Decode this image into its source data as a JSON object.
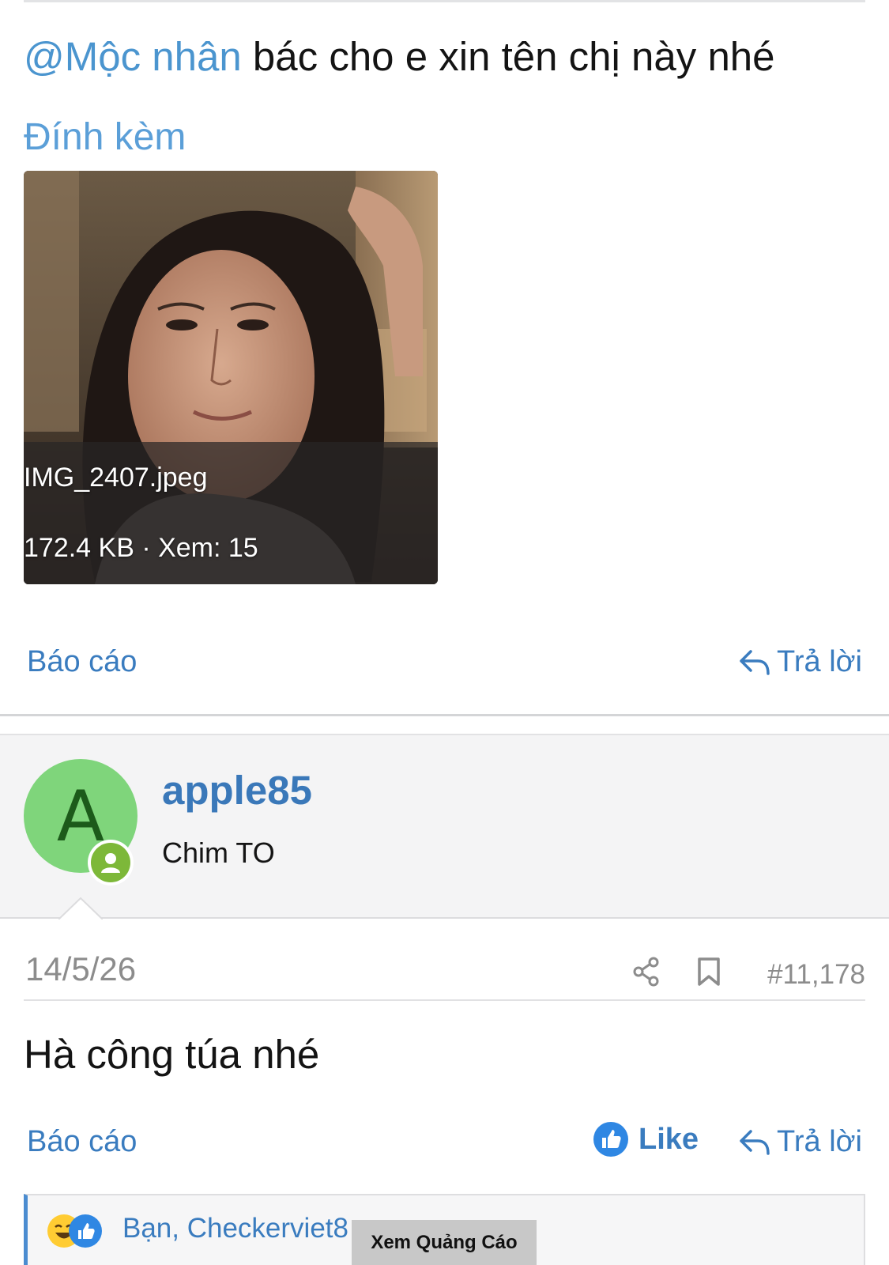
{
  "post1": {
    "mention": "@Mộc nhân",
    "text": " bác cho e xin tên chị này nhé",
    "attachments_title": "Đính kèm",
    "attachment": {
      "filename": "IMG_2407.jpeg",
      "meta": "172.4 KB · Xem: 15"
    },
    "report_label": "Báo cáo",
    "reply_label": "Trả lời"
  },
  "post2": {
    "avatar_letter": "A",
    "username": "apple85",
    "user_title": "Chim TO",
    "date": "14/5/26",
    "post_number": "#11,178",
    "text": "Hà công túa nhé",
    "report_label": "Báo cáo",
    "like_label": "Like",
    "reply_label": "Trả lời",
    "reactions_text": "Bạn, Checkerviet8"
  },
  "ad": {
    "label": "Xem Quảng Cáo"
  },
  "colors": {
    "link": "#3a7cbf",
    "avatar_bg": "#7fd57b",
    "online_badge": "#7db839"
  }
}
